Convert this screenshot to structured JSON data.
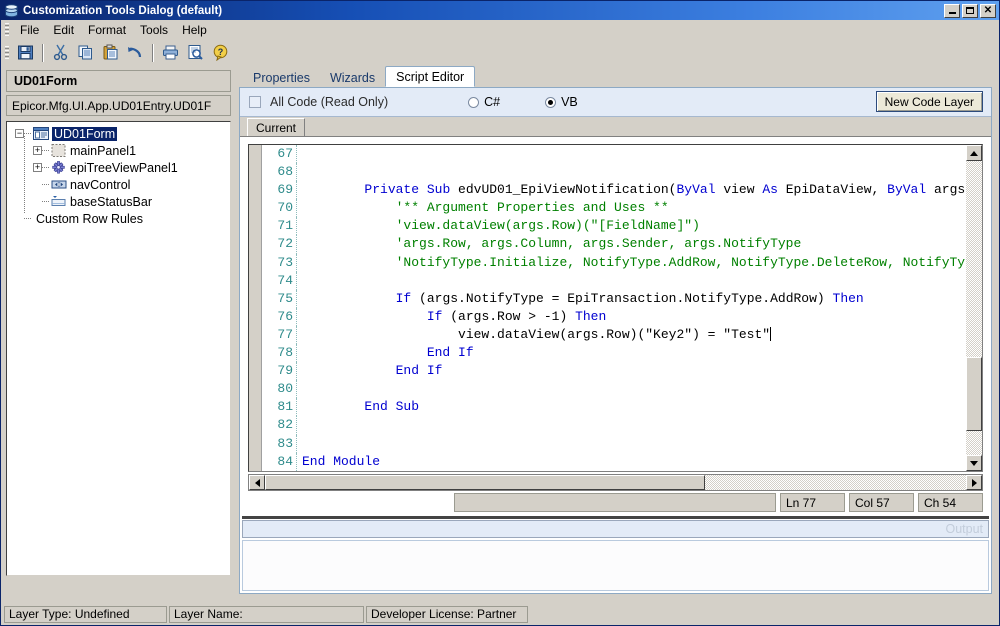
{
  "window": {
    "title": "Customization Tools Dialog (default)",
    "icon": "app-database-icon",
    "buttons": {
      "minimize": "_",
      "maximize": "□",
      "close": "✕"
    }
  },
  "menu": {
    "items": [
      "File",
      "Edit",
      "Format",
      "Tools",
      "Help"
    ]
  },
  "toolbar": {
    "buttons": [
      {
        "name": "save-icon",
        "title": "Save"
      },
      {
        "name": "cut-icon",
        "title": "Cut"
      },
      {
        "name": "copy-icon",
        "title": "Copy"
      },
      {
        "name": "paste-icon",
        "title": "Paste"
      },
      {
        "name": "undo-icon",
        "title": "Undo"
      },
      {
        "name": "print-icon",
        "title": "Print"
      },
      {
        "name": "print-preview-icon",
        "title": "Print Preview"
      },
      {
        "name": "help-icon",
        "title": "Help"
      }
    ]
  },
  "left_panel": {
    "header": "UD01Form",
    "subheader": "Epicor.Mfg.UI.App.UD01Entry.UD01F",
    "tree": [
      {
        "label": "UD01Form",
        "icon": "form-icon",
        "expander": "-",
        "selected": true,
        "depth": 0
      },
      {
        "label": "mainPanel1",
        "icon": "panel-icon",
        "expander": "+",
        "selected": false,
        "depth": 1
      },
      {
        "label": "epiTreeViewPanel1",
        "icon": "gear-icon",
        "expander": "+",
        "selected": false,
        "depth": 1
      },
      {
        "label": "navControl",
        "icon": "nav-control-icon",
        "expander": "",
        "selected": false,
        "depth": 1
      },
      {
        "label": "baseStatusBar",
        "icon": "status-bar-icon",
        "expander": "",
        "selected": false,
        "depth": 1
      },
      {
        "label": "Custom Row Rules",
        "icon": "",
        "expander": "",
        "selected": false,
        "depth": 0
      }
    ]
  },
  "tabs": [
    {
      "label": "Properties",
      "active": false
    },
    {
      "label": "Wizards",
      "active": false
    },
    {
      "label": "Script Editor",
      "active": true
    }
  ],
  "options": {
    "all_code_label": "All Code (Read Only)",
    "all_code_checked": false,
    "languages": [
      {
        "label": "C#",
        "selected": false
      },
      {
        "label": "VB",
        "selected": true
      }
    ],
    "new_code_layer_label": "New Code Layer"
  },
  "sub_tabs": [
    {
      "label": "Current",
      "active": true
    }
  ],
  "code": {
    "first_line": 67,
    "lines": [
      {
        "n": 67,
        "parts": []
      },
      {
        "n": 68,
        "parts": []
      },
      {
        "n": 69,
        "parts": [
          {
            "t": "        ",
            "c": "st"
          },
          {
            "t": "Private",
            "c": "kw"
          },
          {
            "t": " ",
            "c": "st"
          },
          {
            "t": "Sub",
            "c": "kw"
          },
          {
            "t": " edvUD01_EpiViewNotification(",
            "c": "st"
          },
          {
            "t": "ByVal",
            "c": "kw"
          },
          {
            "t": " view ",
            "c": "st"
          },
          {
            "t": "As",
            "c": "kw"
          },
          {
            "t": " EpiDataView, ",
            "c": "st"
          },
          {
            "t": "ByVal",
            "c": "kw"
          },
          {
            "t": " args",
            "c": "st"
          }
        ]
      },
      {
        "n": 70,
        "parts": [
          {
            "t": "            '** Argument Properties and Uses **",
            "c": "cm"
          }
        ]
      },
      {
        "n": 71,
        "parts": [
          {
            "t": "            'view.dataView(args.Row)(\"[FieldName]\")",
            "c": "cm"
          }
        ]
      },
      {
        "n": 72,
        "parts": [
          {
            "t": "            'args.Row, args.Column, args.Sender, args.NotifyType",
            "c": "cm"
          }
        ]
      },
      {
        "n": 73,
        "parts": [
          {
            "t": "            'NotifyType.Initialize, NotifyType.AddRow, NotifyType.DeleteRow, NotifyTyp",
            "c": "cm"
          }
        ]
      },
      {
        "n": 74,
        "parts": []
      },
      {
        "n": 75,
        "parts": [
          {
            "t": "            ",
            "c": "st"
          },
          {
            "t": "If",
            "c": "kw"
          },
          {
            "t": " (args.NotifyType = EpiTransaction.NotifyType.AddRow) ",
            "c": "st"
          },
          {
            "t": "Then",
            "c": "kw"
          }
        ]
      },
      {
        "n": 76,
        "parts": [
          {
            "t": "                ",
            "c": "st"
          },
          {
            "t": "If",
            "c": "kw"
          },
          {
            "t": " (args.Row > -1) ",
            "c": "st"
          },
          {
            "t": "Then",
            "c": "kw"
          }
        ]
      },
      {
        "n": 77,
        "parts": [
          {
            "t": "                    view.dataView(args.Row)(\"Key2\") = \"Test\"",
            "c": "st"
          }
        ],
        "caret": true
      },
      {
        "n": 78,
        "parts": [
          {
            "t": "                ",
            "c": "st"
          },
          {
            "t": "End If",
            "c": "kw"
          }
        ]
      },
      {
        "n": 79,
        "parts": [
          {
            "t": "            ",
            "c": "st"
          },
          {
            "t": "End If",
            "c": "kw"
          }
        ]
      },
      {
        "n": 80,
        "parts": []
      },
      {
        "n": 81,
        "parts": [
          {
            "t": "        ",
            "c": "st"
          },
          {
            "t": "End Sub",
            "c": "kw"
          }
        ]
      },
      {
        "n": 82,
        "parts": []
      },
      {
        "n": 83,
        "parts": []
      },
      {
        "n": 84,
        "parts": [
          {
            "t": "End Module",
            "c": "kw"
          }
        ]
      }
    ]
  },
  "editor_status": {
    "line": "Ln 77",
    "column": "Col 57",
    "char": "Ch 54"
  },
  "output": {
    "label": "Output",
    "text": ""
  },
  "status_bar": {
    "layer_type": "Layer Type:  Undefined",
    "layer_name": "Layer Name:",
    "developer_license": "Developer License:  Partner"
  }
}
